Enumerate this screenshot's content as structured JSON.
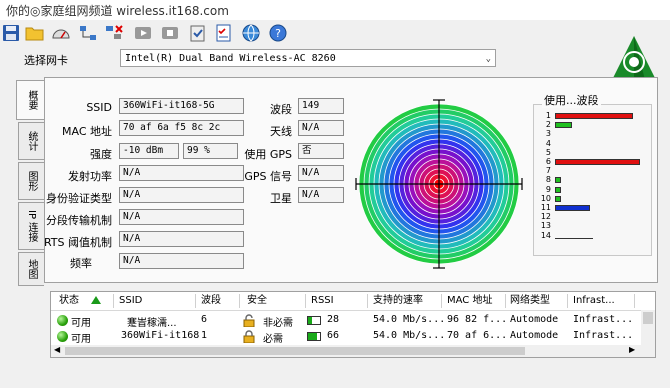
{
  "watermark": "你的◎家庭组网频道 wireless.it168.com",
  "toolbar": {
    "icons": [
      "save-icon",
      "open-folder-icon",
      "speed-gauge-icon",
      "network-tree-icon",
      "disconnect-icon",
      "play-icon",
      "stop-icon",
      "clipboard-icon",
      "checklist-icon",
      "globe-icon",
      "help-icon"
    ]
  },
  "adapter": {
    "label": "选择网卡",
    "selected": "Intel(R) Dual Band Wireless-AC 8260"
  },
  "tabs": [
    "概要",
    "统计",
    "图形",
    "IP 连接",
    "地图"
  ],
  "summary": {
    "ssid_label": "SSID",
    "ssid": "360WiFi-it168-5G",
    "mac_label": "MAC 地址",
    "mac": "70 af 6a f5 8c 2c",
    "strength_label": "强度",
    "strength_dbm": "-10 dBm",
    "strength_pct": "99 %",
    "txpower_label": "发射功率",
    "txpower": "N/A",
    "auth_label": "身份验证类型",
    "auth": "N/A",
    "frag_label": "分段传输机制",
    "frag": "N/A",
    "rts_label": "RTS 阈值机制",
    "rts": "N/A",
    "freq_label": "频率",
    "freq": "N/A",
    "band_label": "波段",
    "band": "149",
    "antenna_label": "天线",
    "antenna": "N/A",
    "gps_use_label": "使用 GPS",
    "gps_use": "否",
    "gps_signal_label": "GPS 信号",
    "gps_signal": "N/A",
    "satellite_label": "卫星",
    "satellite": "N/A"
  },
  "channel_usage": {
    "title": "使用...波段",
    "channels": [
      "1",
      "2",
      "3",
      "4",
      "5",
      "6",
      "7",
      "8",
      "9",
      "10",
      "11",
      "12",
      "13",
      "14"
    ],
    "usage": [
      0.85,
      0.19,
      0,
      0,
      0,
      0.92,
      0,
      0.07,
      0.07,
      0.07,
      0.38,
      0,
      0,
      0
    ],
    "colors": [
      "#e01010",
      "#20c020",
      "",
      "",
      "",
      "#e01010",
      "",
      "#20c020",
      "#20c020",
      "#20c020",
      "#1030d0",
      "",
      "",
      ""
    ]
  },
  "network_list": {
    "columns": [
      "状态",
      "SSID",
      "波段",
      "安全",
      "RSSI",
      "支持的速率",
      "MAC 地址",
      "网络类型",
      "Infrast..."
    ],
    "rows": [
      {
        "status": "可用",
        "ssid": "蹇旹稼濡...",
        "band": "6",
        "security": "非必需",
        "rssi": "28",
        "rate": "54.0 Mb/s...",
        "mac": "96 82 f...",
        "type": "Automode",
        "infra": "Infrast..."
      },
      {
        "status": "可用",
        "ssid": "360WiFi-it168",
        "band": "1",
        "security": "必需",
        "rssi": "66",
        "rate": "54.0 Mb/s...",
        "mac": "70 af 6...",
        "type": "Automode",
        "infra": "Infrast..."
      }
    ]
  },
  "colors": {
    "accent": "#2aa20c",
    "selected_row": "#dce8f7"
  }
}
